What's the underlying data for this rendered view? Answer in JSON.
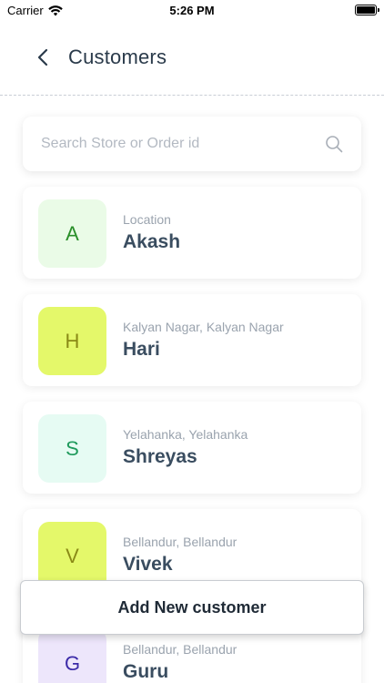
{
  "status_bar": {
    "carrier": "Carrier",
    "time": "5:26 PM"
  },
  "header": {
    "title": "Customers"
  },
  "search": {
    "placeholder": "Search Store or Order id",
    "value": ""
  },
  "customers": [
    {
      "initial": "A",
      "location": "Location",
      "name": "Akash",
      "avatar_bg": "#eafbe7",
      "avatar_fg": "#2a8f2a"
    },
    {
      "initial": "H",
      "location": "Kalyan Nagar, Kalyan Nagar",
      "name": "Hari",
      "avatar_bg": "#e4f86a",
      "avatar_fg": "#8a8a16"
    },
    {
      "initial": "S",
      "location": "Yelahanka, Yelahanka",
      "name": "Shreyas",
      "avatar_bg": "#e6fbf3",
      "avatar_fg": "#1f9a5c"
    },
    {
      "initial": "V",
      "location": "Bellandur, Bellandur",
      "name": "Vivek",
      "avatar_bg": "#e4f86a",
      "avatar_fg": "#8a8a16"
    },
    {
      "initial": "G",
      "location": "Bellandur, Bellandur",
      "name": "Guru",
      "avatar_bg": "#ede6fb",
      "avatar_fg": "#3b2aa8"
    }
  ],
  "actions": {
    "add_customer_label": "Add New customer"
  },
  "icons": {
    "back": "chevron-left-icon",
    "search": "magnifier-icon",
    "wifi": "wifi-icon",
    "battery": "battery-icon"
  }
}
